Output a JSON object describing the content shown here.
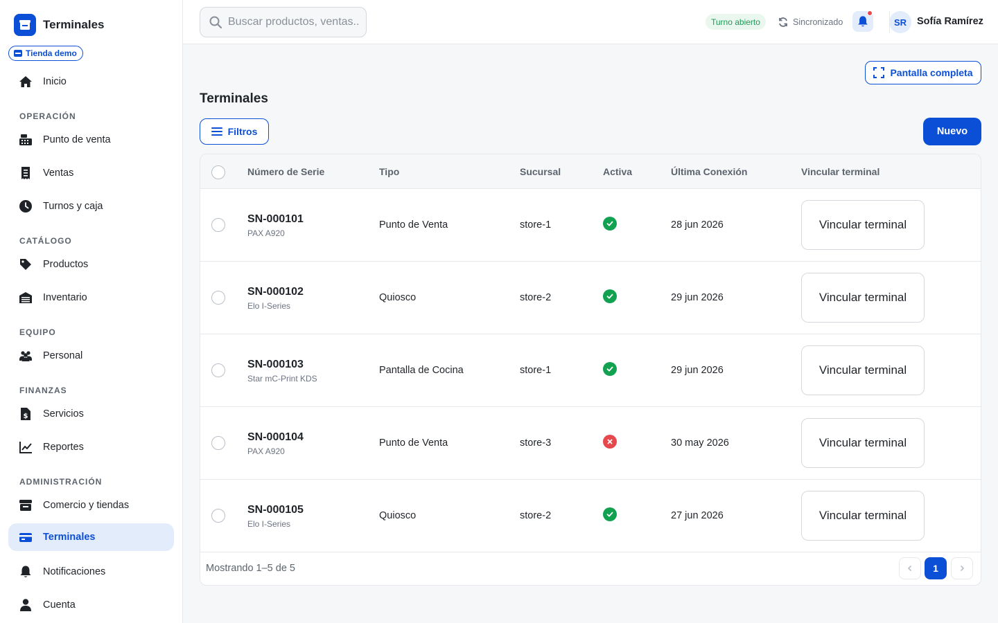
{
  "app": {
    "title": "Terminales",
    "store_badge": "Tienda demo"
  },
  "sidebar": {
    "home": "Inicio",
    "sections": {
      "operacion": "OPERACIÓN",
      "catalogo": "CATÁLOGO",
      "equipo": "EQUIPO",
      "finanzas": "FINANZAS",
      "administracion": "ADMINISTRACIÓN"
    },
    "items": {
      "punto_venta": "Punto de venta",
      "ventas": "Ventas",
      "turnos": "Turnos y caja",
      "productos": "Productos",
      "inventario": "Inventario",
      "personal": "Personal",
      "servicios": "Servicios",
      "reportes": "Reportes",
      "comercio": "Comercio y tiendas",
      "terminales": "Terminales",
      "notificaciones": "Notificaciones",
      "cuenta": "Cuenta"
    },
    "active": "terminales"
  },
  "topbar": {
    "search_placeholder": "Buscar productos, ventas...",
    "shift_status": "Turno abierto",
    "sync_status": "Sincronizado",
    "user_initials": "SR",
    "user_name": "Sofía Ramírez"
  },
  "main": {
    "fullscreen_label": "Pantalla completa",
    "page_title": "Terminales",
    "filters_label": "Filtros",
    "new_label": "Nuevo"
  },
  "table": {
    "columns": {
      "serial": "Número de Serie",
      "type": "Tipo",
      "branch": "Sucursal",
      "active": "Activa",
      "last_connection": "Última Conexión",
      "link": "Vincular terminal"
    },
    "rows": [
      {
        "serial": "SN-000101",
        "model": "PAX A920",
        "type": "Punto de Venta",
        "branch": "store-1",
        "active": true,
        "last": "28 jun 2026",
        "action": "Vincular terminal"
      },
      {
        "serial": "SN-000102",
        "model": "Elo I-Series",
        "type": "Quiosco",
        "branch": "store-2",
        "active": true,
        "last": "29 jun 2026",
        "action": "Vincular terminal"
      },
      {
        "serial": "SN-000103",
        "model": "Star mC-Print KDS",
        "type": "Pantalla de Cocina",
        "branch": "store-1",
        "active": true,
        "last": "29 jun 2026",
        "action": "Vincular terminal"
      },
      {
        "serial": "SN-000104",
        "model": "PAX A920",
        "type": "Punto de Venta",
        "branch": "store-3",
        "active": false,
        "last": "30 may 2026",
        "action": "Vincular terminal"
      },
      {
        "serial": "SN-000105",
        "model": "Elo I-Series",
        "type": "Quiosco",
        "branch": "store-2",
        "active": true,
        "last": "27 jun 2026",
        "action": "Vincular terminal"
      }
    ],
    "footer": "Mostrando 1–5 de 5",
    "current_page": "1",
    "prev_icon": "chevron-left-icon",
    "next_icon": "chevron-right-icon"
  },
  "colors": {
    "accent": "#0a4fd6",
    "success": "#12a150",
    "danger": "#e5484d"
  }
}
